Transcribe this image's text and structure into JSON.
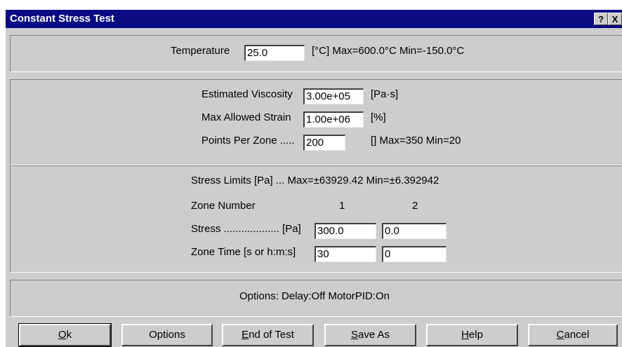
{
  "window": {
    "title": "Constant Stress Test",
    "help_glyph": "?",
    "close_glyph": "X"
  },
  "temperature": {
    "label": "Temperature",
    "value": "25.0",
    "range": "[°C] Max=600.0°C  Min=-150.0°C"
  },
  "params": {
    "viscosity": {
      "label": "Estimated Viscosity",
      "value": "3.00e+05",
      "unit": "[Pa·s]"
    },
    "strain": {
      "label": "Max Allowed Strain",
      "value": "1.00e+06",
      "unit": "[%]"
    },
    "points": {
      "label": "Points Per Zone .....",
      "value": "200",
      "range": "[] Max=350 Min=20"
    }
  },
  "zones": {
    "limits": "Stress Limits [Pa] ... Max=±63929.42  Min=±6.392942",
    "zone_label": "Zone Number",
    "zone_numbers": [
      "1",
      "2"
    ],
    "stress_label": "Stress ...................  [Pa]",
    "stress_values": [
      "300.0",
      "0.0"
    ],
    "time_label": "Zone Time   [s or h:m:s]",
    "time_values": [
      "30",
      "0"
    ]
  },
  "options_text": "Options:  Delay:Off  MotorPID:On",
  "buttons": [
    "Ok",
    "Options",
    "End of Test",
    "Save As",
    "Help",
    "Cancel"
  ],
  "button_mnemonics": [
    "O",
    "",
    "E",
    "S",
    "H",
    "C"
  ]
}
